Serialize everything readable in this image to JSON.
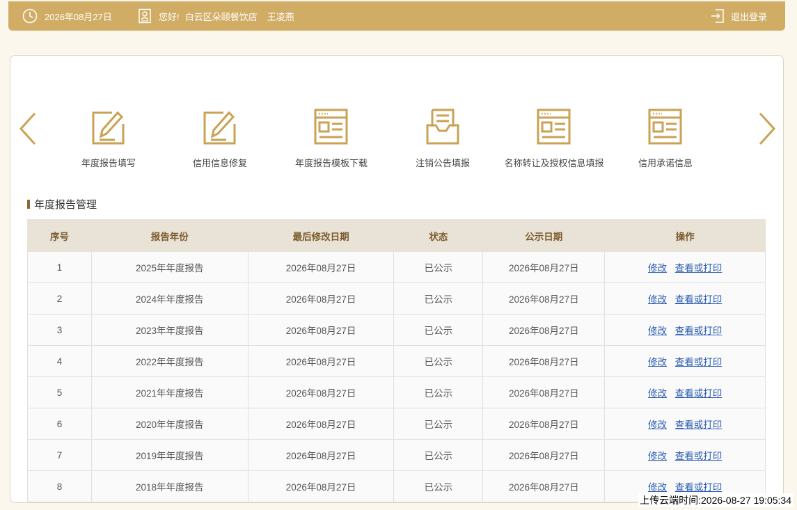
{
  "header": {
    "date": "2026年08月27日",
    "greeting": "您好!",
    "company": "白云区朵颐餐饮店",
    "user": "王凌燕",
    "logout_label": "退出登录"
  },
  "tiles": [
    {
      "label": "年度报告填写",
      "icon": "edit-form-icon"
    },
    {
      "label": "信用信息修复",
      "icon": "edit-form-icon"
    },
    {
      "label": "年度报告模板下载",
      "icon": "document-template-icon"
    },
    {
      "label": "注销公告填报",
      "icon": "inbox-tray-icon"
    },
    {
      "label": "名称转让及授权信息填报",
      "icon": "document-template-icon"
    },
    {
      "label": "信用承诺信息",
      "icon": "document-template-icon"
    }
  ],
  "section": {
    "title": "年度报告管理"
  },
  "table": {
    "headers": [
      "序号",
      "报告年份",
      "最后修改日期",
      "状态",
      "公示日期",
      "操作"
    ],
    "rows": [
      {
        "no": "1",
        "year": "2025年年度报告",
        "modified": "2026年08月27日",
        "status": "已公示",
        "published": "2026年08月27日"
      },
      {
        "no": "2",
        "year": "2024年年度报告",
        "modified": "2026年08月27日",
        "status": "已公示",
        "published": "2026年08月27日"
      },
      {
        "no": "3",
        "year": "2023年年度报告",
        "modified": "2026年08月27日",
        "status": "已公示",
        "published": "2026年08月27日"
      },
      {
        "no": "4",
        "year": "2022年年度报告",
        "modified": "2026年08月27日",
        "status": "已公示",
        "published": "2026年08月27日"
      },
      {
        "no": "5",
        "year": "2021年年度报告",
        "modified": "2026年08月27日",
        "status": "已公示",
        "published": "2026年08月27日"
      },
      {
        "no": "6",
        "year": "2020年年度报告",
        "modified": "2026年08月27日",
        "status": "已公示",
        "published": "2026年08月27日"
      },
      {
        "no": "7",
        "year": "2019年年度报告",
        "modified": "2026年08月27日",
        "status": "已公示",
        "published": "2026年08月27日"
      },
      {
        "no": "8",
        "year": "2018年年度报告",
        "modified": "2026年08月27日",
        "status": "已公示",
        "published": "2026年08月27日"
      }
    ],
    "edit_label": "修改",
    "view_label": "查看或打印"
  },
  "footer": {
    "upload_time": "上传云端时间:2026-08-27 19:05:34"
  },
  "colors": {
    "accent": "#d0ac64",
    "icon_gold": "#c9a254",
    "link": "#2a5cb3"
  }
}
